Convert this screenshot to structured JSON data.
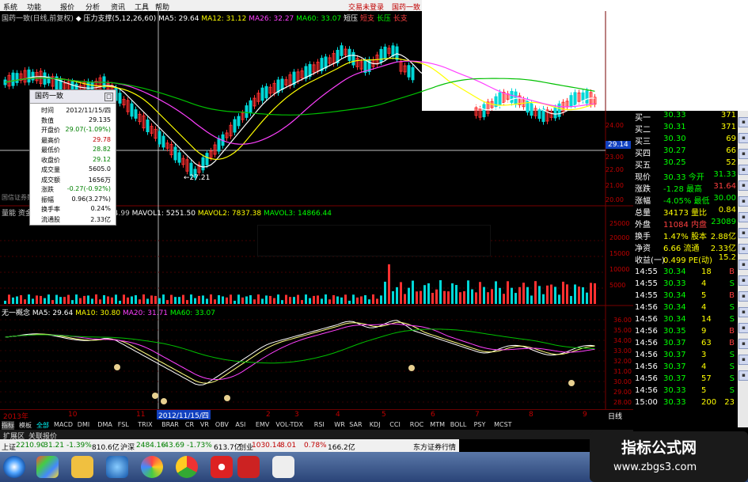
{
  "menu": {
    "items": [
      "系统",
      "功能",
      "报价",
      "分析",
      "资讯",
      "工具",
      "帮助"
    ],
    "right": [
      "交易未登录",
      "国药一致"
    ]
  },
  "main": {
    "header": [
      {
        "text": "国药一致(日线,前复权)",
        "color": "#c8c8c8"
      },
      {
        "text": "◆ 压力支撑(5,12,26,60)",
        "color": "#ffffff"
      },
      {
        "text": "MA5: 29.64",
        "color": "#ffffff"
      },
      {
        "text": "MA12: 31.12",
        "color": "#ffff00"
      },
      {
        "text": "MA26: 32.27",
        "color": "#ff40ff"
      },
      {
        "text": "MA60: 33.07",
        "color": "#00ff00"
      },
      {
        "text": "短压",
        "color": "#ffffff"
      },
      {
        "text": "短支",
        "color": "#ff4040"
      },
      {
        "text": "长压",
        "color": "#00ff00"
      },
      {
        "text": "长支",
        "color": "#ff4040"
      }
    ],
    "price_ticks": [
      "24.00",
      "23.00",
      "22.00",
      "21.00",
      "20.00"
    ],
    "low_label": "←27.21",
    "crosshair_price": "29.14",
    "mid_label": "国信证券数据"
  },
  "infobox": {
    "title": "国药一致",
    "rows": [
      {
        "k": "时间",
        "v": "2012/11/15/四",
        "c": "#000000"
      },
      {
        "k": "数值",
        "v": "29.135",
        "c": "#000000"
      },
      {
        "k": "开盘价",
        "v": "29.07(-1.09%)",
        "c": "#008000"
      },
      {
        "k": "最高价",
        "v": "29.78",
        "c": "#c00000"
      },
      {
        "k": "最低价",
        "v": "28.82",
        "c": "#008000"
      },
      {
        "k": "收盘价",
        "v": "29.12",
        "c": "#008000"
      },
      {
        "k": "成交量",
        "v": "5605.0",
        "c": "#000000"
      },
      {
        "k": "成交额",
        "v": "1656万",
        "c": "#000000"
      },
      {
        "k": "涨跌",
        "v": "-0.27(-0.92%)",
        "c": "#008000"
      },
      {
        "k": "振幅",
        "v": "0.96(3.27%)",
        "c": "#000000"
      },
      {
        "k": "换手率",
        "v": "0.24%",
        "c": "#000000"
      },
      {
        "k": "流通股",
        "v": "2.33亿",
        "c": "#000000"
      }
    ]
  },
  "volume": {
    "header": [
      {
        "text": "量能 资金",
        "color": "#c8c8c8"
      },
      {
        "text": "4.99",
        "color": "#c8c8c8"
      },
      {
        "text": "MAVOL1: 5251.50",
        "color": "#ffffff"
      },
      {
        "text": "MAVOL2: 7837.38",
        "color": "#ffff00"
      },
      {
        "text": "MAVOL3: 14866.44",
        "color": "#00ff00"
      }
    ],
    "ticks": [
      "25000",
      "20000",
      "15000",
      "10000",
      "5000"
    ]
  },
  "indicator": {
    "header": [
      {
        "text": "无一概念",
        "color": "#ffffff"
      },
      {
        "text": "MA5: 29.64",
        "color": "#ffffff"
      },
      {
        "text": "MA10: 30.80",
        "color": "#ffff00"
      },
      {
        "text": "MA20: 31.71",
        "color": "#ff40ff"
      },
      {
        "text": "MA60: 33.07",
        "color": "#00ff00"
      }
    ],
    "ticks": [
      "36.00",
      "35.00",
      "34.00",
      "33.00",
      "32.00",
      "31.00",
      "30.00",
      "29.00",
      "28.00"
    ]
  },
  "xaxis": {
    "labels": [
      "2013年",
      "10",
      "11",
      "2012/11/15/四",
      "2",
      "3",
      "4",
      "5",
      "6",
      "7",
      "8",
      "9"
    ],
    "right": "日线"
  },
  "quote": {
    "rows": [
      {
        "a": "买一",
        "b": "30.33",
        "c": "371",
        "ca": "#ffffff",
        "cb": "#00ff00",
        "cc": "#ffff00"
      },
      {
        "a": "买二",
        "b": "30.31",
        "c": "371",
        "ca": "#ffffff",
        "cb": "#00ff00",
        "cc": "#ffff00"
      },
      {
        "a": "买三",
        "b": "30.30",
        "c": "69",
        "ca": "#ffffff",
        "cb": "#00ff00",
        "cc": "#ffff00"
      },
      {
        "a": "买四",
        "b": "30.27",
        "c": "66",
        "ca": "#ffffff",
        "cb": "#00ff00",
        "cc": "#ffff00"
      },
      {
        "a": "买五",
        "b": "30.25",
        "c": "52",
        "ca": "#ffffff",
        "cb": "#00ff00",
        "cc": "#ffff00"
      },
      {
        "a": "现价",
        "b": "30.33 今开",
        "c": "31.33",
        "ca": "#ffffff",
        "cb": "#00ff00",
        "cc": "#00ff00"
      },
      {
        "a": "涨跌",
        "b": "-1.28 最高",
        "c": "31.64",
        "ca": "#ffffff",
        "cb": "#00ff00",
        "cc": "#ff4040"
      },
      {
        "a": "涨幅",
        "b": "-4.05% 最低",
        "c": "30.00",
        "ca": "#ffffff",
        "cb": "#00ff00",
        "cc": "#00ff00"
      },
      {
        "a": "总量",
        "b": "34173 量比",
        "c": "0.84",
        "ca": "#ffffff",
        "cb": "#ffff00",
        "cc": "#ffff00"
      },
      {
        "a": "外盘",
        "b": "11084 内盘",
        "c": "23089",
        "ca": "#ffffff",
        "cb": "#ff4040",
        "cc": "#00ff00"
      },
      {
        "a": "换手",
        "b": "1.47% 股本",
        "c": "2.88亿",
        "ca": "#ffffff",
        "cb": "#ffff00",
        "cc": "#ffff00"
      },
      {
        "a": "净资",
        "b": "6.66 流通",
        "c": "2.33亿",
        "ca": "#ffffff",
        "cb": "#ffff00",
        "cc": "#ffff00"
      },
      {
        "a": "收益(一)",
        "b": "0.499 PE(动)",
        "c": "15.2",
        "ca": "#ffffff",
        "cb": "#ffff00",
        "cc": "#ffff00"
      }
    ],
    "ticks": [
      {
        "t": "14:55",
        "p": "30.34",
        "v": "18",
        "s": "B"
      },
      {
        "t": "14:55",
        "p": "30.33",
        "v": "4",
        "s": "S"
      },
      {
        "t": "14:55",
        "p": "30.34",
        "v": "5",
        "s": "B"
      },
      {
        "t": "14:56",
        "p": "30.34",
        "v": "4",
        "s": "S"
      },
      {
        "t": "14:56",
        "p": "30.34",
        "v": "14",
        "s": "S"
      },
      {
        "t": "14:56",
        "p": "30.35",
        "v": "9",
        "s": "B"
      },
      {
        "t": "14:56",
        "p": "30.37",
        "v": "63",
        "s": "B"
      },
      {
        "t": "14:56",
        "p": "30.37",
        "v": "3",
        "s": "S"
      },
      {
        "t": "14:56",
        "p": "30.37",
        "v": "4",
        "s": "S"
      },
      {
        "t": "14:56",
        "p": "30.37",
        "v": "57",
        "s": "S"
      },
      {
        "t": "14:56",
        "p": "30.33",
        "v": "5",
        "s": "S"
      },
      {
        "t": "15:00",
        "p": "30.33",
        "v": "200",
        "s": "23"
      }
    ]
  },
  "indicator_tabs": [
    "指标",
    "模板",
    "全部",
    "MACD",
    "DMI",
    "DMA",
    "FSL",
    "TRIX",
    "BRAR",
    "CR",
    "VR",
    "OBV",
    "ASI",
    "EMV",
    "VOL-TDX",
    "RSI",
    "WR",
    "SAR",
    "KDJ",
    "CCI",
    "ROC",
    "MTM",
    "BOLL",
    "PSY",
    "MCST"
  ],
  "ext_tabs": [
    "扩展区",
    "关联报价"
  ],
  "status": [
    {
      "text": "上证",
      "color": "#000000"
    },
    {
      "text": "2210.90",
      "color": "#008000"
    },
    {
      "text": "-31.21",
      "color": "#008000"
    },
    {
      "text": "-1.39%",
      "color": "#008000"
    },
    {
      "text": "810.6亿",
      "color": "#000000"
    },
    {
      "text": "沪深",
      "color": "#000000"
    },
    {
      "text": "2484.16",
      "color": "#008000"
    },
    {
      "text": "-43.69",
      "color": "#008000"
    },
    {
      "text": "-1.73%",
      "color": "#008000"
    },
    {
      "text": "613.7亿",
      "color": "#000000"
    },
    {
      "text": "创业",
      "color": "#000000"
    },
    {
      "text": "1030.14",
      "color": "#c00000"
    },
    {
      "text": "8.01",
      "color": "#c00000"
    },
    {
      "text": "0.78%",
      "color": "#c00000"
    },
    {
      "text": "166.2亿",
      "color": "#000000"
    },
    {
      "text": "东方证券行情主站",
      "color": "#000000"
    }
  ],
  "watermark": {
    "title": "指标公式网",
    "url": "www.zbgs3.com"
  },
  "colors": {
    "up": "#ff3030",
    "down": "#00d8d8",
    "ma5": "#ffffff",
    "ma12": "#ffff00",
    "ma26": "#ff40ff",
    "ma60": "#00c000"
  }
}
